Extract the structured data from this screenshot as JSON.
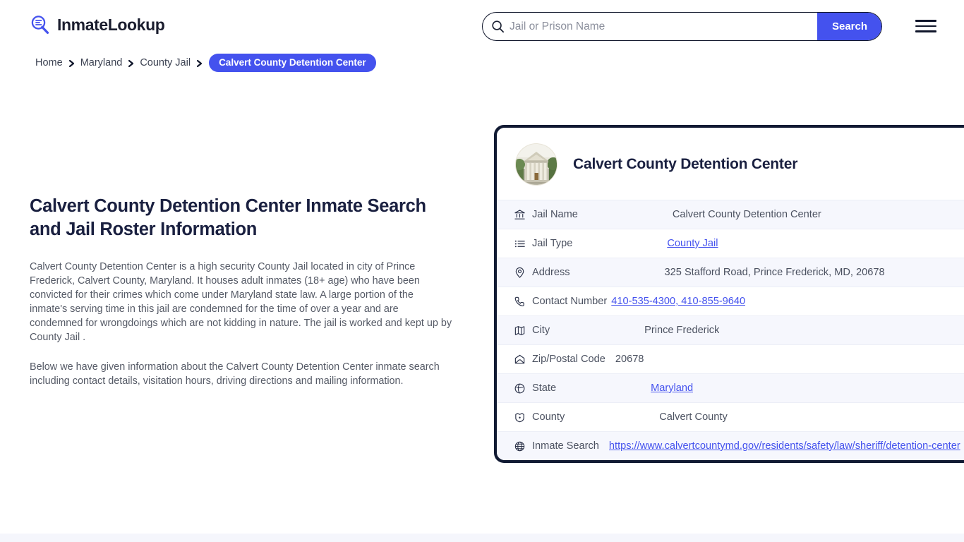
{
  "brand": {
    "name": "InmateLookup",
    "icon": "magnifier-list-icon"
  },
  "search": {
    "placeholder": "Jail or Prison Name",
    "value": "",
    "button_label": "Search",
    "icon": "search-icon"
  },
  "menu": {
    "icon": "hamburger-menu-icon"
  },
  "breadcrumb": {
    "items": [
      {
        "label": "Home"
      },
      {
        "label": "Maryland"
      },
      {
        "label": "County Jail"
      }
    ],
    "current": "Calvert County Detention Center"
  },
  "main": {
    "title": "Calvert County Detention Center Inmate Search and Jail Roster Information",
    "paragraph1": "Calvert County Detention Center is a high security County Jail located in city of Prince Frederick, Calvert County, Maryland. It houses adult inmates (18+ age) who have been convicted for their crimes which come under Maryland state law. A large portion of the inmate's serving time in this jail are condemned for the time of over a year and are condemned for wrongdoings which are not kidding in nature. The jail is worked and kept up by County Jail .",
    "paragraph2": "Below we have given information about the Calvert County Detention Center inmate search including contact details, visitation hours, driving directions and mailing information."
  },
  "card": {
    "title": "Calvert County Detention Center",
    "avatar_icon": "courthouse-photo",
    "rows": [
      {
        "icon": "bank-icon",
        "label": "Jail Name",
        "value": "Calvert County Detention Center",
        "link": false
      },
      {
        "icon": "list-icon",
        "label": "Jail Type",
        "value": "County Jail",
        "link": true
      },
      {
        "icon": "location-pin-icon",
        "label": "Address",
        "value": "325 Stafford Road, Prince Frederick, MD, 20678",
        "link": false
      },
      {
        "icon": "phone-icon",
        "label": "Contact Number",
        "value": "410-535-4300, 410-855-9640",
        "link": true
      },
      {
        "icon": "map-icon",
        "label": "City",
        "value": "Prince Frederick",
        "link": false
      },
      {
        "icon": "envelope-icon",
        "label": "Zip/Postal Code",
        "value": "20678",
        "link": false
      },
      {
        "icon": "globe-icon",
        "label": "State",
        "value": "Maryland",
        "link": true
      },
      {
        "icon": "badge-icon",
        "label": "County",
        "value": "Calvert County",
        "link": false
      },
      {
        "icon": "globe-alt-icon",
        "label": "Inmate Search",
        "value": "https://www.calvertcountymd.gov/residents/safety/law/sheriff/detention-center",
        "link": true
      }
    ]
  },
  "colors": {
    "accent": "#4452ee",
    "card_border": "#111a33",
    "row_alt": "#f6f7fd",
    "heading": "#1a2040",
    "body_text": "#555a66",
    "footer_band": "#f5f6fc"
  }
}
